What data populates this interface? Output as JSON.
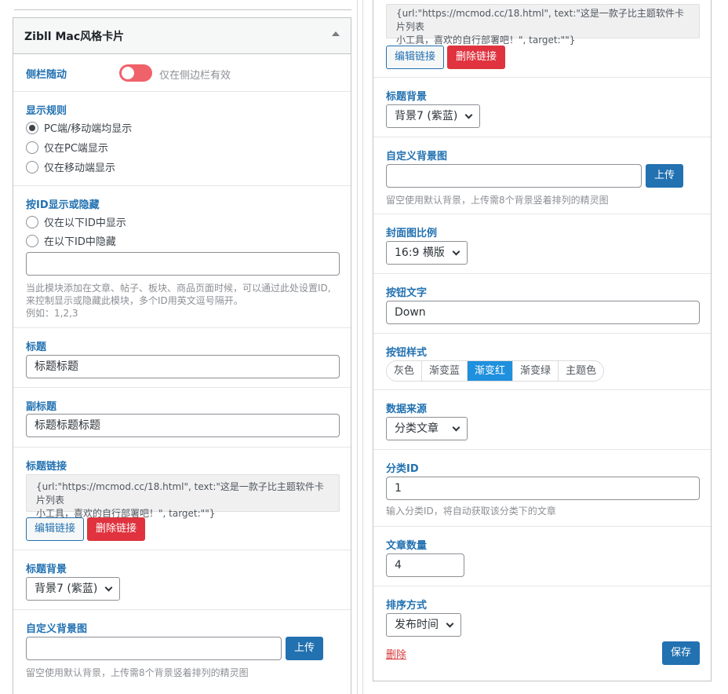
{
  "left_widget": {
    "title": "Zibll Mac风格卡片",
    "sidebar_follow": {
      "label": "侧栏随动",
      "toggle_on": true,
      "note": "仅在侧边栏有效"
    },
    "display_rule": {
      "label": "显示规则",
      "options": [
        "PC端/移动端均显示",
        "仅在PC端显示",
        "仅在移动端显示"
      ],
      "selected_index": 0
    },
    "id_visibility": {
      "label": "按ID显示或隐藏",
      "options": [
        "仅在以下ID中显示",
        "在以下ID中隐藏"
      ],
      "input_value": "",
      "help_line1": "当此模块添加在文章、帖子、板块、商品页面时候，可以通过此处设置ID,",
      "help_line2": "来控制显示或隐藏此模块，多个ID用英文逗号隔开。",
      "help_line3": "例如：1,2,3"
    },
    "title_field": {
      "label": "标题",
      "value": "标题标题"
    },
    "subtitle_field": {
      "label": "副标题",
      "value": "标题标题标题"
    },
    "title_link": {
      "label": "标题链接",
      "value_line1": "{url:\"https://mcmod.cc/18.html\", text:\"这是一款子比主题软件卡片列表",
      "value_line2": "小工具，喜欢的自行部署吧！\", target:\"\"}",
      "edit_label": "编辑链接",
      "delete_label": "删除链接"
    },
    "title_bg": {
      "label": "标题背景",
      "selected": "背景7 (紫蓝)"
    },
    "custom_bg": {
      "label": "自定义背景图",
      "value": "",
      "upload_label": "上传",
      "help": "留空使用默认背景，上传需8个背景竖着排列的精灵图"
    }
  },
  "right_widget": {
    "title_link": {
      "value_line1": "{url:\"https://mcmod.cc/18.html\", text:\"这是一款子比主题软件卡片列表",
      "value_line2": "小工具，喜欢的自行部署吧！\", target:\"\"}",
      "edit_label": "编辑链接",
      "delete_label": "删除链接"
    },
    "title_bg": {
      "label": "标题背景",
      "selected": "背景7 (紫蓝)"
    },
    "custom_bg": {
      "label": "自定义背景图",
      "value": "",
      "upload_label": "上传",
      "help": "留空使用默认背景，上传需8个背景竖着排列的精灵图"
    },
    "cover_ratio": {
      "label": "封面图比例",
      "selected": "16:9 横版"
    },
    "button_text": {
      "label": "按钮文字",
      "value": "Down"
    },
    "button_style": {
      "label": "按钮样式",
      "options": [
        "灰色",
        "渐变蓝",
        "渐变红",
        "渐变绿",
        "主题色"
      ],
      "selected_index": 2
    },
    "data_source": {
      "label": "数据来源",
      "selected": "分类文章"
    },
    "category_id": {
      "label": "分类ID",
      "value": "1",
      "help": "输入分类ID，将自动获取该分类下的文章"
    },
    "post_count": {
      "label": "文章数量",
      "value": "4"
    },
    "order_by": {
      "label": "排序方式",
      "selected": "发布时间"
    },
    "delete_label": "删除",
    "save_label": "保存"
  },
  "colors": {
    "accent": "#2271b1",
    "danger": "#e0333f",
    "toggle": "#f0626a",
    "segment_active": "#1e90dd"
  }
}
